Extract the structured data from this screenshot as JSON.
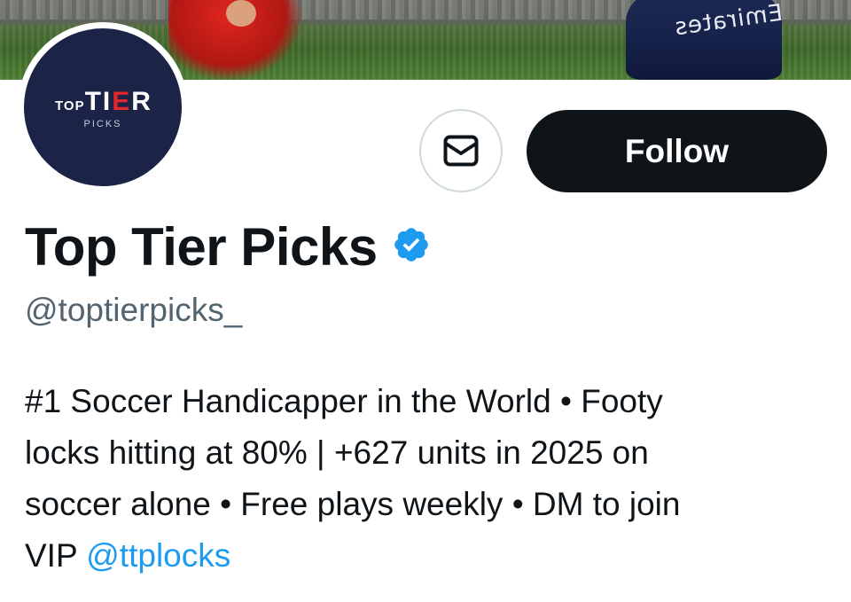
{
  "banner": {
    "sponsor_text": "Emirates"
  },
  "avatar": {
    "logo_top": "TOP",
    "logo_tier_a": "TI",
    "logo_tier_red": "E",
    "logo_tier_b": "R",
    "logo_sub": "PICKS",
    "background_color": "#1b2447",
    "accent_color": "#e3262c"
  },
  "actions": {
    "message_icon": "envelope-icon",
    "follow_label": "Follow"
  },
  "profile": {
    "display_name": "Top Tier Picks",
    "verified_icon": "verified-badge-icon",
    "verified_color": "#1d9bf0",
    "handle": "@toptierpicks_",
    "bio_lines": [
      "#1 Soccer Handicapper in the World • Footy",
      "locks hitting at 80% | +627 units in 2025 on",
      "soccer alone • Free plays weekly • DM to join"
    ],
    "bio_last_prefix": "VIP ",
    "bio_mention": "@ttplocks"
  },
  "colors": {
    "text_primary": "#0f1419",
    "text_secondary": "#536471",
    "link": "#1d9bf0",
    "button_dark": "#0f1419",
    "border": "#cfd9de"
  }
}
